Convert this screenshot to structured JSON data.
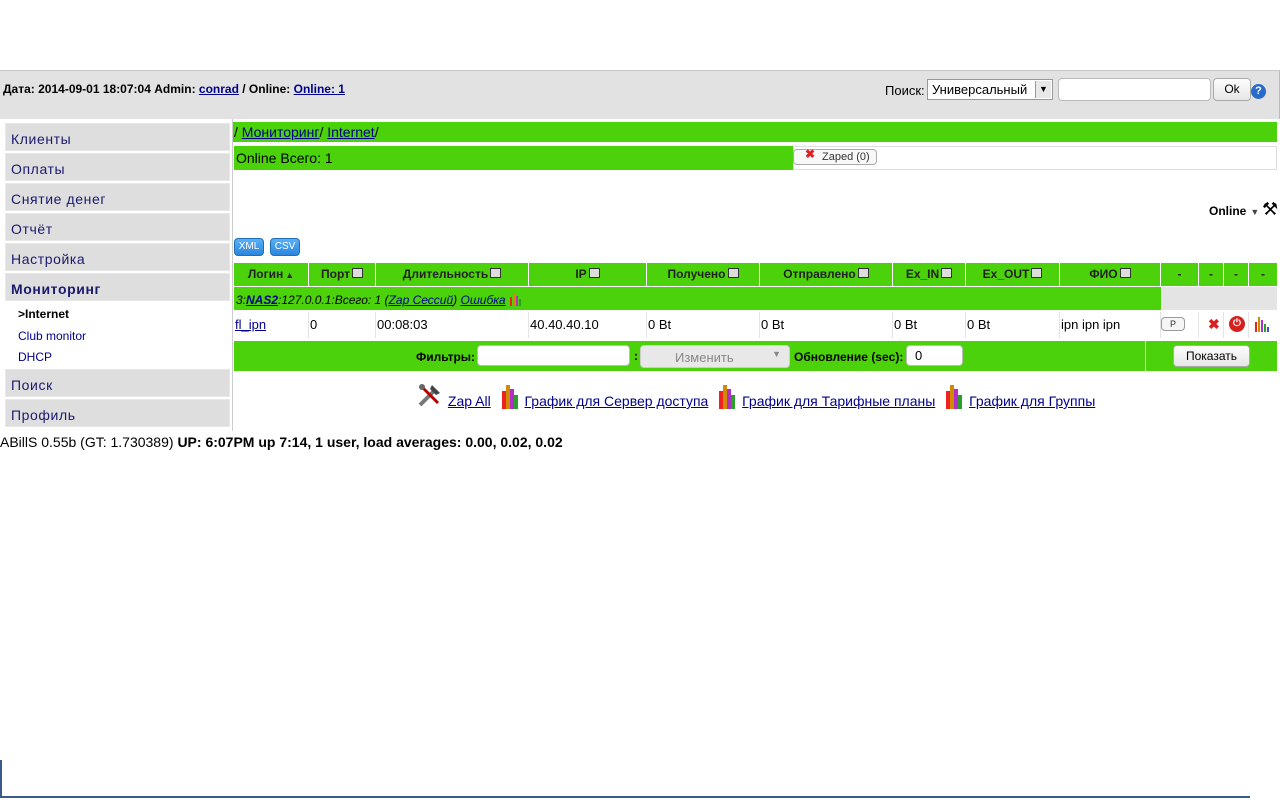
{
  "header": {
    "date_label": "Дата:",
    "date_value": "2014-09-01 18:07:04",
    "admin_label": "Admin:",
    "admin_name": "conrad",
    "online_sep": "/ Online:",
    "online_link": "Online: 1",
    "search_label": "Поиск:",
    "search_type": "Универсальный",
    "search_value": "",
    "ok_label": "Ok",
    "help": "?"
  },
  "sidebar": {
    "items": [
      {
        "label": "Клиенты"
      },
      {
        "label": "Оплаты"
      },
      {
        "label": "Снятие денег"
      },
      {
        "label": "Отчёт"
      },
      {
        "label": "Настройка"
      },
      {
        "label": "Мониторинг"
      },
      {
        "label": "Поиск"
      },
      {
        "label": "Профиль"
      }
    ],
    "subitems": [
      {
        "label": ">Internet"
      },
      {
        "label": "Club monitor"
      },
      {
        "label": "DHCP"
      }
    ]
  },
  "breadcrumb": {
    "sep": "/",
    "monitoring": "Мониторинг",
    "internet": "Internet"
  },
  "online_total": "Online Всего: 1",
  "zaped_label": "Zaped (0)",
  "online_menu": "Online",
  "export": {
    "xml": "XML",
    "csv": "CSV"
  },
  "table": {
    "headers": [
      "Логин",
      "Порт",
      "Длительность",
      "IP",
      "Получено",
      "Отправлено",
      "Ex_IN",
      "Ex_OUT",
      "ФИО",
      "-",
      "-",
      "-",
      "-"
    ],
    "group": {
      "prefix": "3:",
      "nas": "NAS2",
      "info": ":127.0.0.1:Всего: 1 (",
      "zap": "Zap Сессий",
      "close": ")",
      "error": "Ошибка"
    },
    "rows": [
      {
        "login": "fl_ipn",
        "port": "0",
        "duration": "00:08:03",
        "ip": "40.40.40.10",
        "received": "0 Bt",
        "sent": "0 Bt",
        "ex_in": "0 Bt",
        "ex_out": "0 Bt",
        "fio": "ipn ipn ipn",
        "p": "P"
      }
    ]
  },
  "filters": {
    "label": "Фильтры:",
    "value": "",
    "colon": ":",
    "change": "Изменить",
    "update_label": "Обновление (sec):",
    "update_value": "0",
    "show": "Показать"
  },
  "links": {
    "zap_all": "Zap All",
    "graph_nas": "График для Сервер доступа",
    "graph_tp": "График для Тарифные планы",
    "graph_groups": "График для Группы"
  },
  "footer": {
    "version": "ABillS 0.55b (GT: 1.730389)",
    "uptime": "UP: 6:07PM up 7:14, 1 user, load averages: 0.00, 0.02, 0.02"
  },
  "colors": {
    "accent_green": "#4cd20a",
    "link": "#00008b",
    "menu_bg": "#dedede"
  }
}
